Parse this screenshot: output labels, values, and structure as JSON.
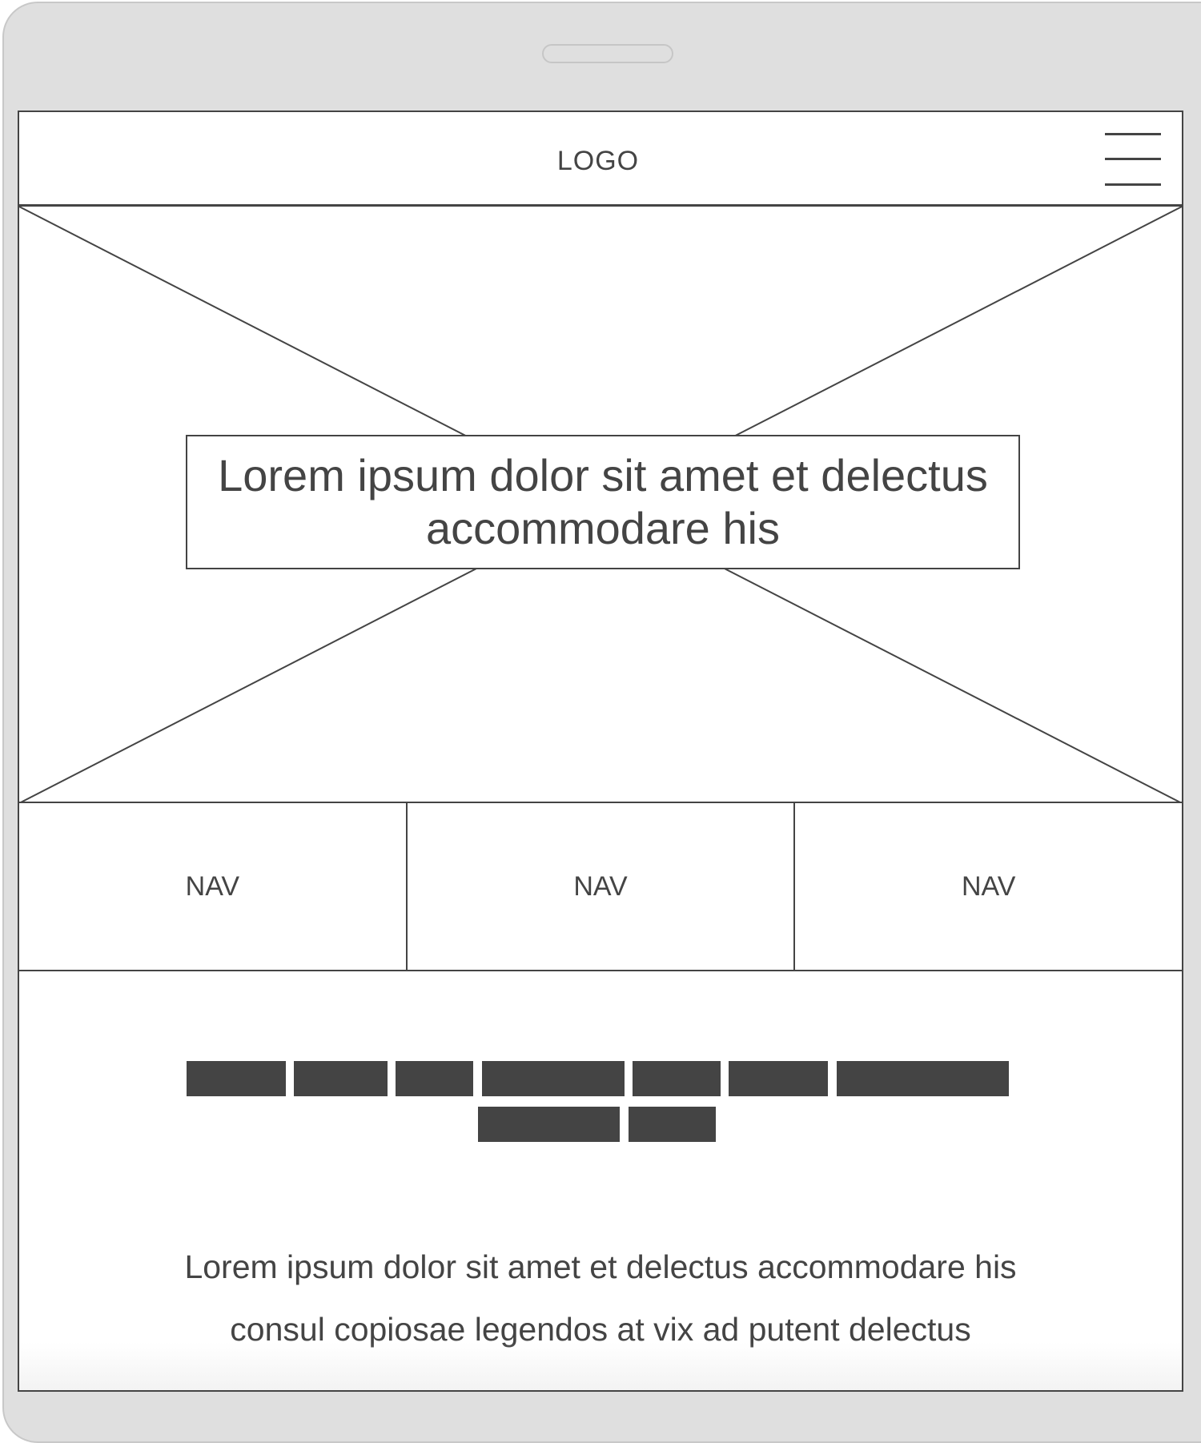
{
  "header": {
    "logo": "LOGO",
    "menu_icon": "hamburger-menu-icon"
  },
  "hero": {
    "placeholder_icon": "image-placeholder-icon",
    "caption": "Lorem ipsum dolor sit amet et delectus accommodare his"
  },
  "nav": {
    "items": [
      {
        "label": "NAV"
      },
      {
        "label": "NAV"
      },
      {
        "label": "NAV"
      }
    ]
  },
  "content": {
    "heading_placeholder": "redacted-text-blocks",
    "paragraph_line1": "Lorem ipsum dolor sit amet et delectus accommodare his",
    "paragraph_line2": "consul copiosae legendos at vix ad putent delectus"
  },
  "colors": {
    "device_frame": "#dfdfdf",
    "ink": "#444444",
    "screen": "#ffffff"
  }
}
